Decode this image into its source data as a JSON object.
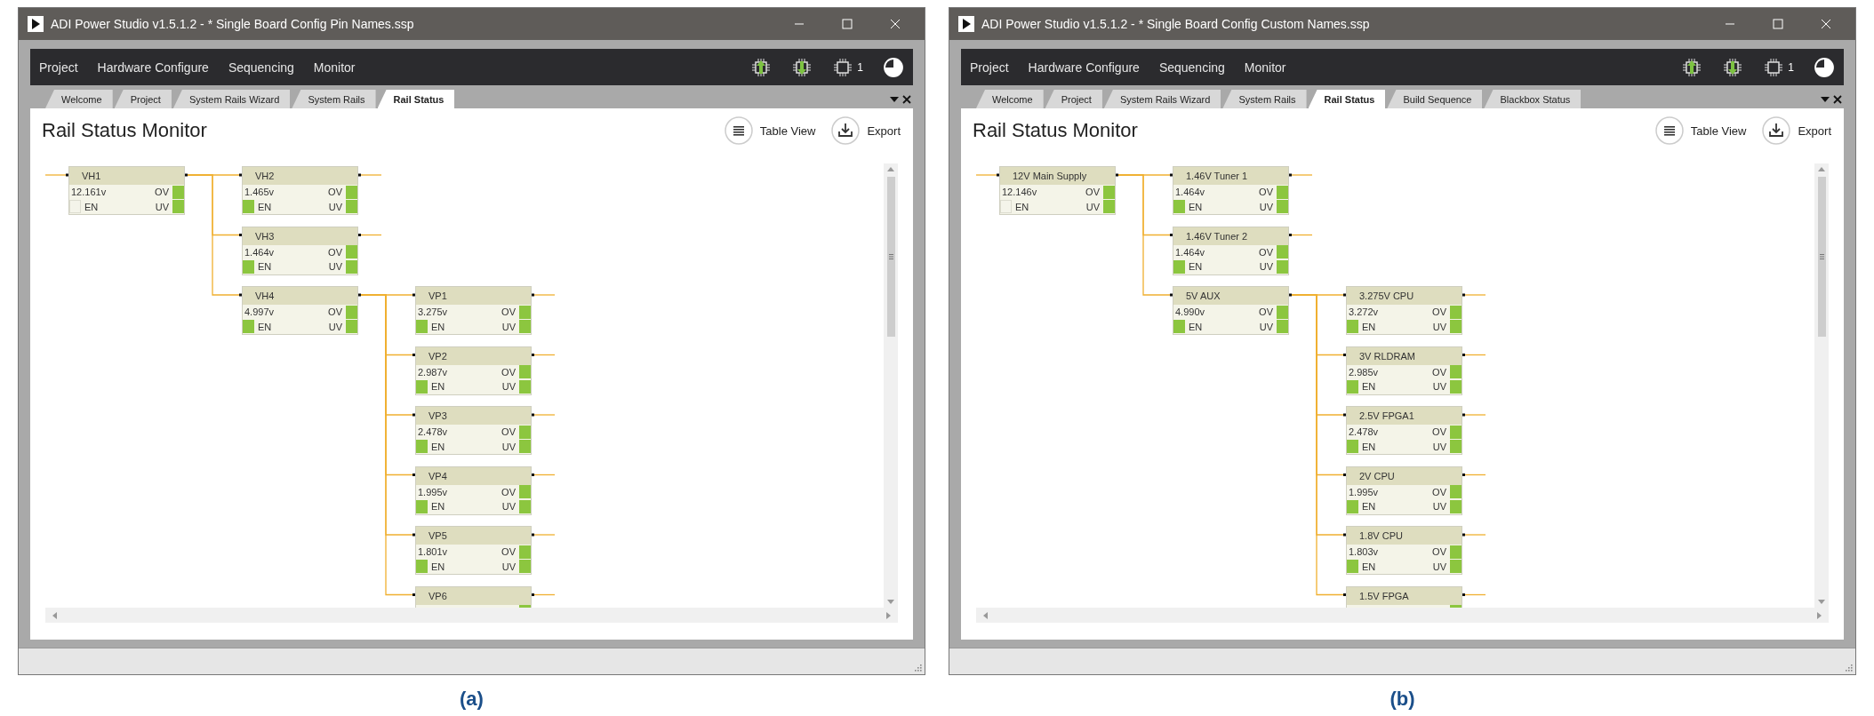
{
  "panels": [
    {
      "caption": "(a)",
      "window": {
        "title": "ADI Power Studio v1.5.1.2 - * Single Board Config Pin Names.ssp",
        "menu": [
          "Project",
          "Hardware Configure",
          "Sequencing",
          "Monitor"
        ],
        "device_count": "1",
        "tabs": [
          {
            "label": "Welcome",
            "selected": false
          },
          {
            "label": "Project",
            "selected": false
          },
          {
            "label": "System Rails Wizard",
            "selected": false
          },
          {
            "label": "System Rails",
            "selected": false
          },
          {
            "label": "Rail Status",
            "selected": true
          }
        ],
        "page_title": "Rail Status Monitor",
        "actions": [
          {
            "kind": "table",
            "label": "Table View"
          },
          {
            "kind": "export",
            "label": "Export"
          }
        ],
        "rail_tree": {
          "kind": "full",
          "name": "VH1",
          "reading": "12.161v",
          "ov": {
            "label": "OV",
            "on": true
          },
          "en": {
            "label": "EN",
            "on": false
          },
          "uv": {
            "label": "UV",
            "on": true
          },
          "children": [
            {
              "kind": "full",
              "name": "VH2",
              "reading": "1.465v",
              "ov": {
                "label": "OV",
                "on": true
              },
              "en": {
                "label": "EN",
                "on": true
              },
              "uv": {
                "label": "UV",
                "on": true
              }
            },
            {
              "kind": "full",
              "name": "VH3",
              "reading": "1.464v",
              "ov": {
                "label": "OV",
                "on": true
              },
              "en": {
                "label": "EN",
                "on": true
              },
              "uv": {
                "label": "UV",
                "on": true
              }
            },
            {
              "kind": "full",
              "name": "VH4",
              "reading": "4.997v",
              "ov": {
                "label": "OV",
                "on": true
              },
              "en": {
                "label": "EN",
                "on": true
              },
              "uv": {
                "label": "UV",
                "on": true
              },
              "children": [
                {
                  "kind": "full",
                  "name": "VP1",
                  "reading": "3.275v",
                  "ov": {
                    "label": "OV",
                    "on": true
                  },
                  "en": {
                    "label": "EN",
                    "on": true
                  },
                  "uv": {
                    "label": "UV",
                    "on": true
                  }
                },
                {
                  "kind": "full",
                  "name": "VP2",
                  "reading": "2.987v",
                  "ov": {
                    "label": "OV",
                    "on": true
                  },
                  "en": {
                    "label": "EN",
                    "on": true
                  },
                  "uv": {
                    "label": "UV",
                    "on": true
                  }
                },
                {
                  "kind": "full",
                  "name": "VP3",
                  "reading": "2.478v",
                  "ov": {
                    "label": "OV",
                    "on": true
                  },
                  "en": {
                    "label": "EN",
                    "on": true
                  },
                  "uv": {
                    "label": "UV",
                    "on": true
                  }
                },
                {
                  "kind": "full",
                  "name": "VP4",
                  "reading": "1.995v",
                  "ov": {
                    "label": "OV",
                    "on": true
                  },
                  "en": {
                    "label": "EN",
                    "on": true
                  },
                  "uv": {
                    "label": "UV",
                    "on": true
                  }
                },
                {
                  "kind": "full",
                  "name": "VP5",
                  "reading": "1.801v",
                  "ov": {
                    "label": "OV",
                    "on": true
                  },
                  "en": {
                    "label": "EN",
                    "on": true
                  },
                  "uv": {
                    "label": "UV",
                    "on": true
                  }
                },
                {
                  "kind": "partial",
                  "name": "VP6",
                  "ov": {
                    "on": true
                  }
                }
              ]
            }
          ]
        }
      }
    },
    {
      "caption": "(b)",
      "window": {
        "title": "ADI Power Studio v1.5.1.2 - * Single Board Config Custom Names.ssp",
        "menu": [
          "Project",
          "Hardware Configure",
          "Sequencing",
          "Monitor"
        ],
        "device_count": "1",
        "tabs": [
          {
            "label": "Welcome",
            "selected": false
          },
          {
            "label": "Project",
            "selected": false
          },
          {
            "label": "System Rails Wizard",
            "selected": false
          },
          {
            "label": "System Rails",
            "selected": false
          },
          {
            "label": "Rail Status",
            "selected": true
          },
          {
            "label": "Build Sequence",
            "selected": false
          },
          {
            "label": "Blackbox Status",
            "selected": false
          }
        ],
        "page_title": "Rail Status Monitor",
        "actions": [
          {
            "kind": "table",
            "label": "Table View"
          },
          {
            "kind": "export",
            "label": "Export"
          }
        ],
        "rail_tree": {
          "kind": "full",
          "name": "12V Main Supply",
          "reading": "12.146v",
          "ov": {
            "label": "OV",
            "on": true
          },
          "en": {
            "label": "EN",
            "on": false
          },
          "uv": {
            "label": "UV",
            "on": true
          },
          "children": [
            {
              "kind": "full",
              "name": "1.46V Tuner 1",
              "reading": "1.464v",
              "ov": {
                "label": "OV",
                "on": true
              },
              "en": {
                "label": "EN",
                "on": true
              },
              "uv": {
                "label": "UV",
                "on": true
              }
            },
            {
              "kind": "full",
              "name": "1.46V Tuner 2",
              "reading": "1.464v",
              "ov": {
                "label": "OV",
                "on": true
              },
              "en": {
                "label": "EN",
                "on": true
              },
              "uv": {
                "label": "UV",
                "on": true
              }
            },
            {
              "kind": "full",
              "name": "5V AUX",
              "reading": "4.990v",
              "ov": {
                "label": "OV",
                "on": true
              },
              "en": {
                "label": "EN",
                "on": true
              },
              "uv": {
                "label": "UV",
                "on": true
              },
              "children": [
                {
                  "kind": "full",
                  "name": "3.275V CPU",
                  "reading": "3.272v",
                  "ov": {
                    "label": "OV",
                    "on": true
                  },
                  "en": {
                    "label": "EN",
                    "on": true
                  },
                  "uv": {
                    "label": "UV",
                    "on": true
                  }
                },
                {
                  "kind": "full",
                  "name": "3V RLDRAM",
                  "reading": "2.985v",
                  "ov": {
                    "label": "OV",
                    "on": true
                  },
                  "en": {
                    "label": "EN",
                    "on": true
                  },
                  "uv": {
                    "label": "UV",
                    "on": true
                  }
                },
                {
                  "kind": "full",
                  "name": "2.5V FPGA1",
                  "reading": "2.478v",
                  "ov": {
                    "label": "OV",
                    "on": true
                  },
                  "en": {
                    "label": "EN",
                    "on": true
                  },
                  "uv": {
                    "label": "UV",
                    "on": true
                  }
                },
                {
                  "kind": "full",
                  "name": "2V CPU",
                  "reading": "1.995v",
                  "ov": {
                    "label": "OV",
                    "on": true
                  },
                  "en": {
                    "label": "EN",
                    "on": true
                  },
                  "uv": {
                    "label": "UV",
                    "on": true
                  }
                },
                {
                  "kind": "full",
                  "name": "1.8V CPU",
                  "reading": "1.803v",
                  "ov": {
                    "label": "OV",
                    "on": true
                  },
                  "en": {
                    "label": "EN",
                    "on": true
                  },
                  "uv": {
                    "label": "UV",
                    "on": true
                  }
                },
                {
                  "kind": "partial",
                  "name": "1.5V FPGA",
                  "ov": {
                    "on": true
                  }
                }
              ]
            }
          ]
        }
      }
    }
  ]
}
